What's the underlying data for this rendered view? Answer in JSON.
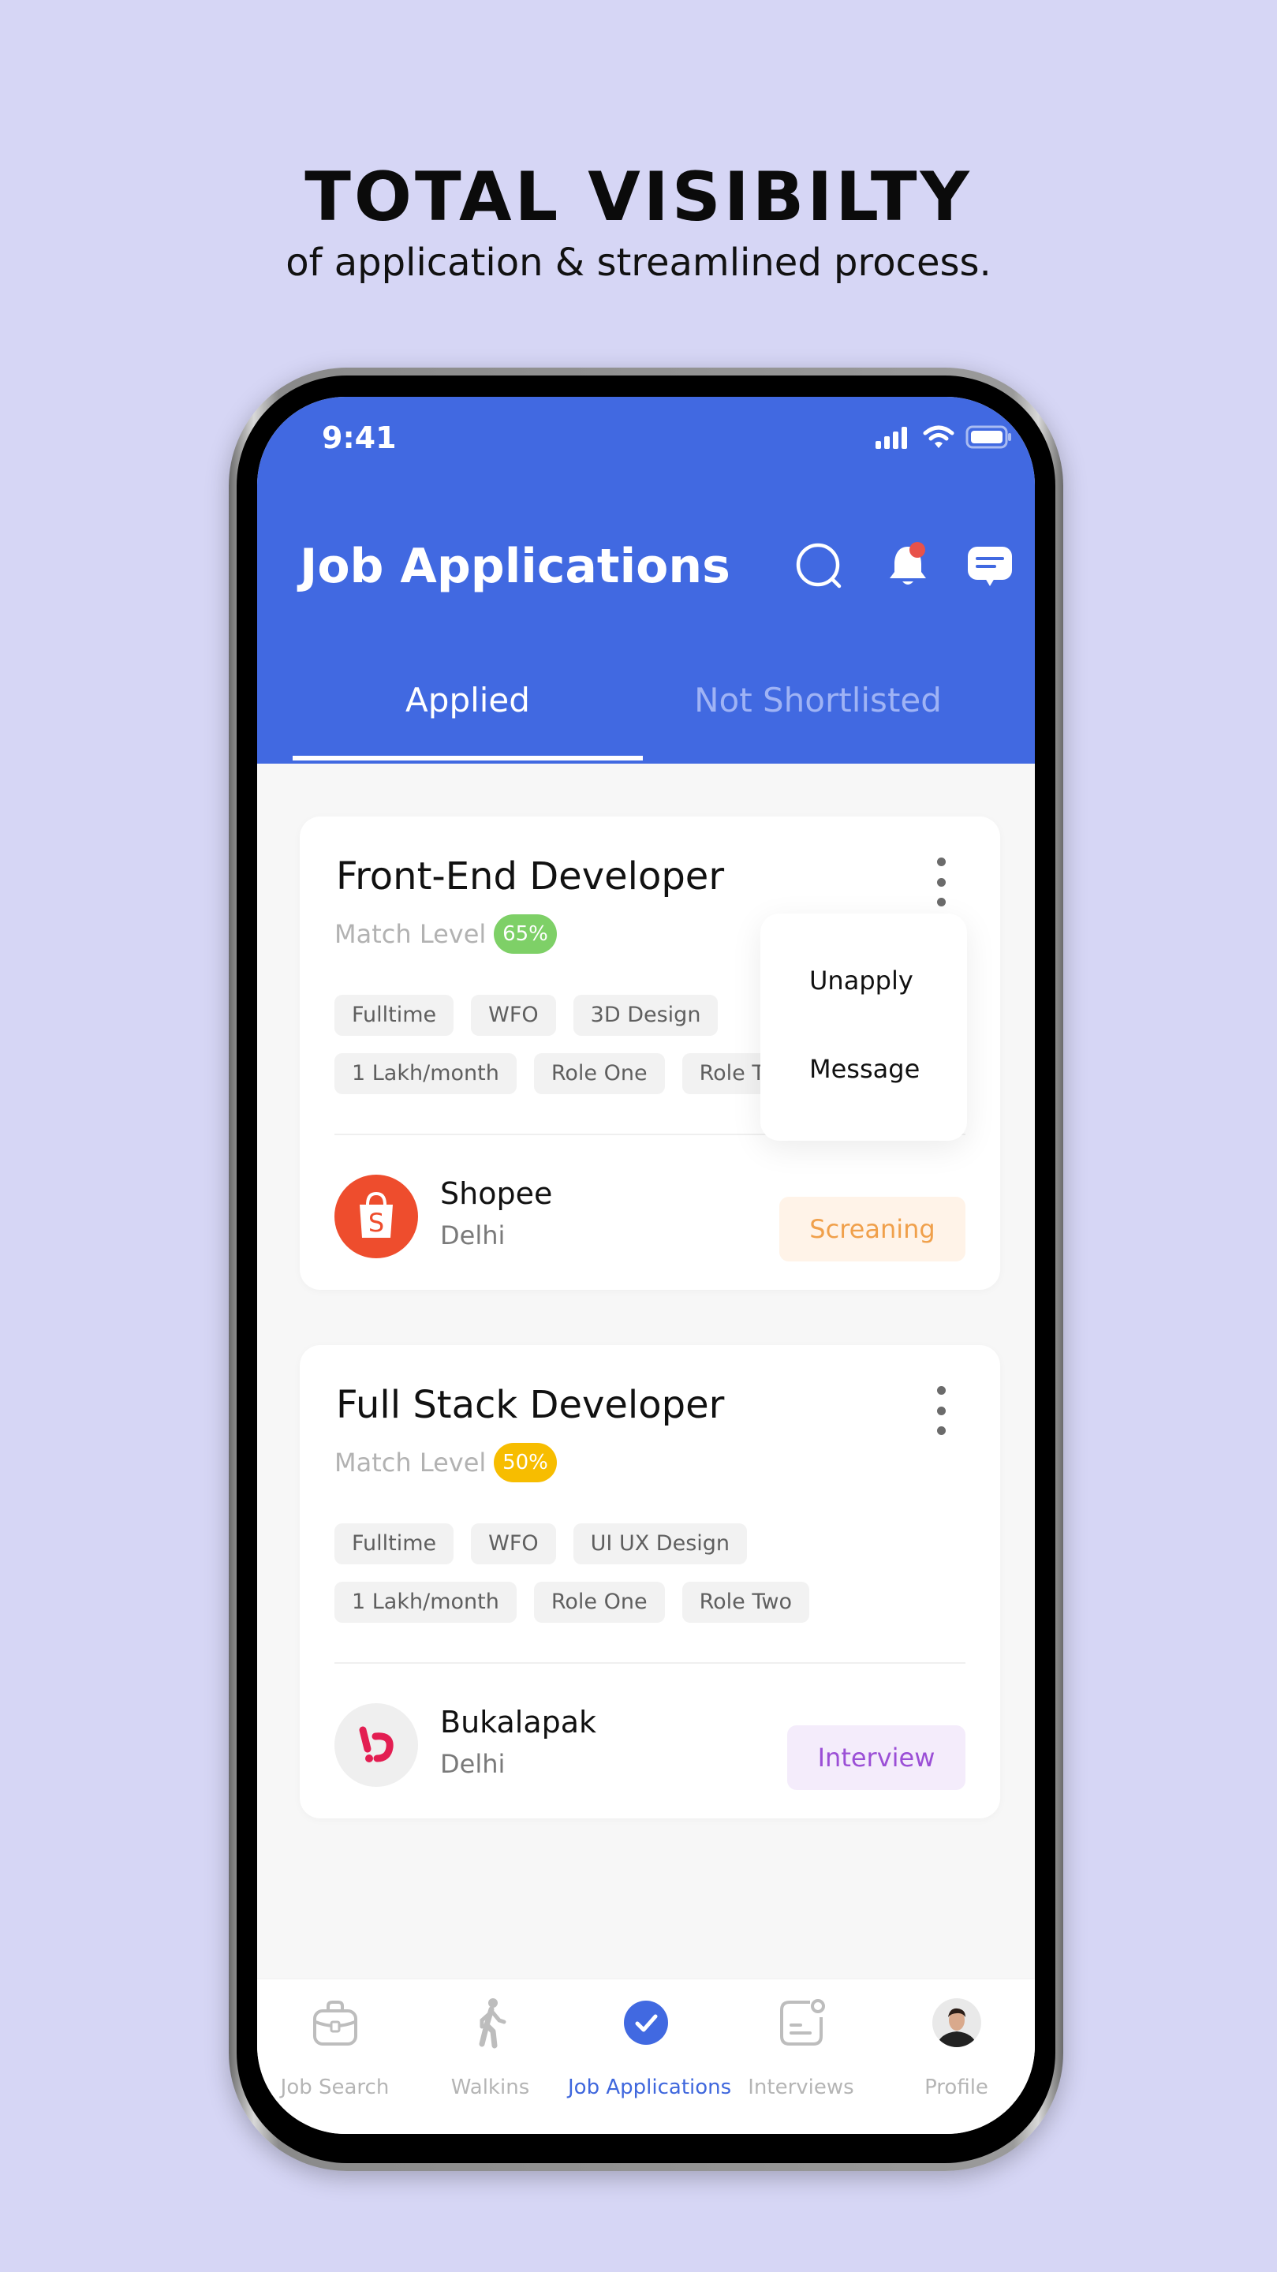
{
  "promo": {
    "headline": "TOTAL VISIBILTY",
    "subline": "of application & streamlined process."
  },
  "status_bar": {
    "time": "9:41",
    "icons": [
      "signal-icon",
      "wifi-icon",
      "battery-icon"
    ]
  },
  "header": {
    "title": "Job Applications",
    "icons": [
      "search-icon",
      "bell-icon",
      "chat-icon"
    ],
    "notification_dot": true
  },
  "tabs": [
    {
      "label": "Applied",
      "active": true
    },
    {
      "label": "Not Shortlisted",
      "active": false
    }
  ],
  "cards": [
    {
      "title": "Front-End Developer",
      "match_label": "Match Level",
      "match_value": "65%",
      "match_color": "#7ed067",
      "chips_row1": [
        "Fulltime",
        "WFO",
        "3D Design"
      ],
      "chips_row2": [
        "1 Lakh/month",
        "Role One",
        "Role Two"
      ],
      "company": "Shopee",
      "city": "Delhi",
      "status": "Screaning",
      "status_color": "#f0a04b",
      "status_bg": "#fff3e8"
    },
    {
      "title": "Full Stack Developer",
      "match_label": "Match Level",
      "match_value": "50%",
      "match_color": "#f7bd00",
      "chips_row1": [
        "Fulltime",
        "WFO",
        "UI UX Design"
      ],
      "chips_row2": [
        "1 Lakh/month",
        "Role One",
        "Role Two"
      ],
      "company": "Bukalapak",
      "city": "Delhi",
      "status": "Interview",
      "status_color": "#9b4fd6",
      "status_bg": "#f4ecfb"
    }
  ],
  "dropdown": {
    "items": [
      "Unapply",
      "Message"
    ]
  },
  "bottom_nav": [
    {
      "label": "Job Search",
      "icon": "briefcase-icon",
      "active": false
    },
    {
      "label": "Walkins",
      "icon": "walking-icon",
      "active": false
    },
    {
      "label": "Job Applications",
      "icon": "check-circle-icon",
      "active": true
    },
    {
      "label": "Interviews",
      "icon": "interviews-icon",
      "active": false
    },
    {
      "label": "Profile",
      "icon": "avatar",
      "active": false
    }
  ],
  "colors": {
    "primary": "#4169e1",
    "background": "#d6d6f5",
    "notification": "#e8524a"
  }
}
